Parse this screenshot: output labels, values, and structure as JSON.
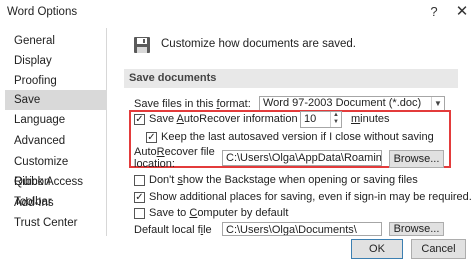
{
  "window": {
    "title": "Word Options",
    "help_icon": "?",
    "close_icon": "✕"
  },
  "sidebar": {
    "items": [
      {
        "label": "General"
      },
      {
        "label": "Display"
      },
      {
        "label": "Proofing"
      },
      {
        "label": "Save",
        "active": true
      },
      {
        "label": "Language"
      },
      {
        "label": "Advanced"
      },
      {
        "label": "Customize Ribbon"
      },
      {
        "label": "Quick Access Toolbar"
      },
      {
        "label": "Add-Ins"
      },
      {
        "label": "Trust Center"
      }
    ]
  },
  "main": {
    "header": "Customize how documents are saved.",
    "section_title": "Save documents",
    "format_label_pre": "Save files in this ",
    "format_label_ul": "f",
    "format_label_post": "ormat:",
    "format_value": "Word 97-2003 Document (*.doc)",
    "autorecover_label_pre": "Save ",
    "autorecover_label_ul": "A",
    "autorecover_label_post": "utoRecover information every",
    "autorecover_checked": true,
    "autorecover_minutes": "10",
    "minutes_label_pre": "",
    "minutes_label_ul": "m",
    "minutes_label_post": "inutes",
    "keep_version_label": "Keep the last autosaved version if I close without saving",
    "keep_version_checked": true,
    "ar_location_label_pre": "Auto",
    "ar_location_label_ul": "R",
    "ar_location_label_post": "ecover file",
    "ar_location_label_line2": "location:",
    "ar_location_value": "C:\\Users\\Olga\\AppData\\Roaming\\Micro",
    "browse_label": "Browse...",
    "backstage_label_pre": "Don't ",
    "backstage_label_ul": "s",
    "backstage_label_post": "how the Backstage when opening or saving files",
    "backstage_checked": false,
    "additional_places_label": "Show additional places for saving, even if sign-in may be required.",
    "additional_places_checked": true,
    "save_computer_label_pre": "Save to ",
    "save_computer_label_ul": "C",
    "save_computer_label_post": "omputer by default",
    "save_computer_checked": false,
    "default_local_label_pre": "Default local f",
    "default_local_label_ul": "i",
    "default_local_label_post": "le",
    "default_local_value": "C:\\Users\\Olga\\Documents\\",
    "browse2_label": "Browse..."
  },
  "footer": {
    "ok_label": "OK",
    "cancel_label": "Cancel"
  },
  "colors": {
    "highlight": "#e33b3b",
    "active_nav": "#d9d9d9",
    "section_bar": "#e8e8e8"
  }
}
